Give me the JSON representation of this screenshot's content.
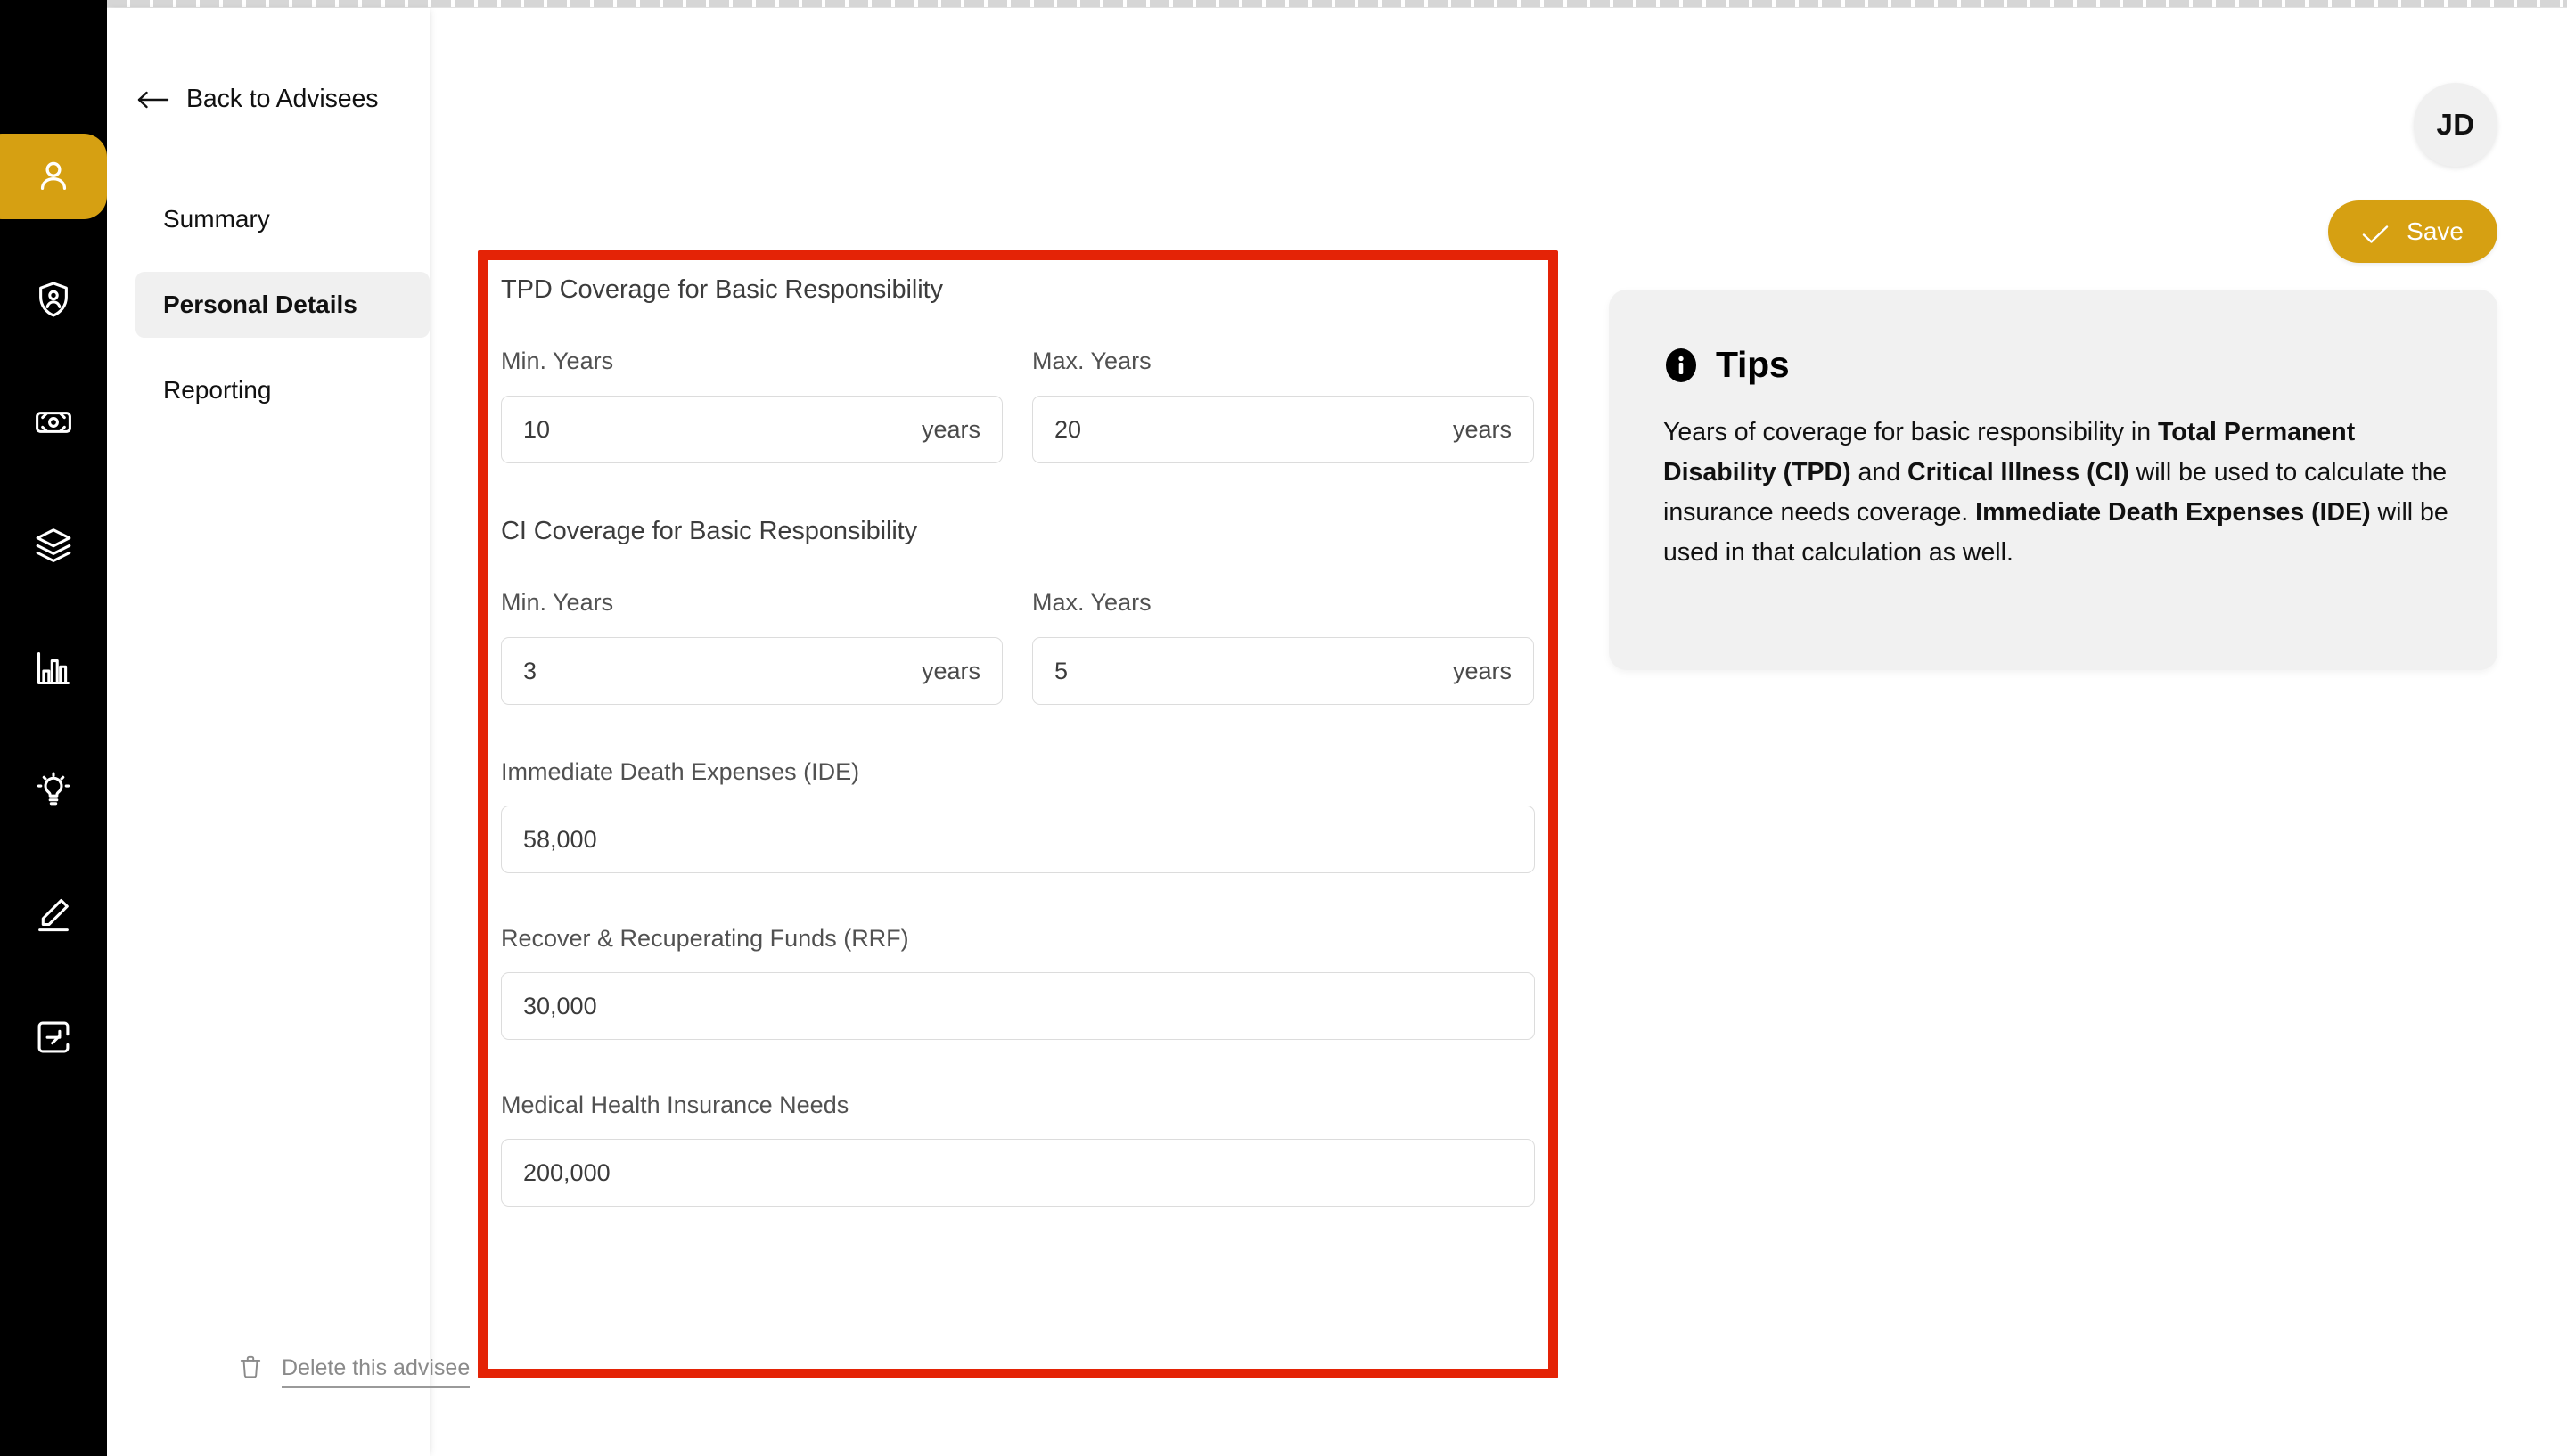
{
  "colors": {
    "rail_bg": "#000000",
    "accent": "#d6a012",
    "annotation": "#e42306",
    "nav_active_bg": "#f0f0f0",
    "tips_bg": "#f1f1f1",
    "input_border": "#dcdcdc"
  },
  "rail": {
    "items": [
      {
        "icon": "person-icon",
        "active": true
      },
      {
        "icon": "shield-person-icon",
        "active": false
      },
      {
        "icon": "banknote-icon",
        "active": false
      },
      {
        "icon": "layers-icon",
        "active": false
      },
      {
        "icon": "bar-chart-icon",
        "active": false
      },
      {
        "icon": "lightbulb-icon",
        "active": false
      },
      {
        "icon": "pencil-icon",
        "active": false
      },
      {
        "icon": "export-icon",
        "active": false
      }
    ]
  },
  "sidebar": {
    "back_label": "Back to Advisees",
    "back_icon": "arrow-left-icon",
    "nav": [
      {
        "label": "Summary",
        "active": false
      },
      {
        "label": "Personal Details",
        "active": true
      },
      {
        "label": "Reporting",
        "active": false
      }
    ],
    "delete": {
      "icon": "trash-icon",
      "label": "Delete this advisee"
    }
  },
  "header": {
    "avatar_initials": "JD",
    "save_label": "Save",
    "save_icon": "check-icon"
  },
  "form": {
    "tpd": {
      "section_title": "TPD Coverage for Basic Responsibility",
      "min_label": "Min. Years",
      "min_value": "10",
      "min_suffix": "years",
      "max_label": "Max. Years",
      "max_value": "20",
      "max_suffix": "years"
    },
    "ci": {
      "section_title": "CI Coverage for Basic Responsibility",
      "min_label": "Min. Years",
      "min_value": "3",
      "min_suffix": "years",
      "max_label": "Max. Years",
      "max_value": "5",
      "max_suffix": "years"
    },
    "ide": {
      "label": "Immediate Death Expenses (IDE)",
      "value": "58,000"
    },
    "rrf": {
      "label": "Recover & Recuperating Funds (RRF)",
      "value": "30,000"
    },
    "mhin": {
      "label": "Medical Health Insurance Needs",
      "value": "200,000"
    }
  },
  "tips": {
    "icon": "info-icon",
    "title": "Tips",
    "body_segments": [
      {
        "text": "Years of coverage for basic responsibility in ",
        "bold": false
      },
      {
        "text": "Total Permanent Disability (TPD)",
        "bold": true
      },
      {
        "text": " and ",
        "bold": false
      },
      {
        "text": "Critical Illness (CI)",
        "bold": true
      },
      {
        "text": " will be used to calculate the insurance needs coverage. ",
        "bold": false
      },
      {
        "text": "Immediate Death Expenses (IDE)",
        "bold": true
      },
      {
        "text": " will be used in that calculation as well.",
        "bold": false
      }
    ]
  }
}
